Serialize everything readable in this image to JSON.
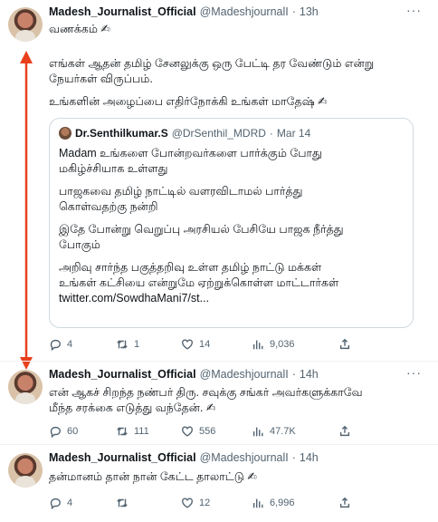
{
  "tweets": [
    {
      "name": "Madesh_Journalist_Official",
      "handle": "@MadeshjournalI",
      "sep": "·",
      "time": "13h",
      "more": "···",
      "lines": [
        "வணக்கம் ✍",
        "எங்கள் ஆதன் தமிழ் சேனலுக்கு ஒரு பேட்டி தர வேண்டும் என்று",
        "நேயர்கள் விருப்பம்.",
        "உங்களின் அழைப்பை எதிர்நோக்கி உங்கள் மாதேஷ் ✍"
      ],
      "quote": {
        "name": "Dr.Senthilkumar.S",
        "handle": "@DrSenthil_MDRD",
        "sep": "·",
        "date": "Mar 14",
        "lines": [
          "Madam உங்களை போன்றவர்களை பார்க்கும் போது",
          "மகிழ்ச்சியாக உள்ளது",
          "பாஜகவை தமிழ் நாட்டில் வளரவிடாமல் பார்த்து",
          "கொள்வதற்கு நன்றி",
          "இதே போன்று வெறுப்பு அரசியல் பேசியே பாஜக நீர்த்து",
          "போகும்",
          "அறிவு சார்ந்த பகுத்தறிவு உள்ள தமிழ் நாட்டு மக்கள்",
          "உங்கள் கட்சியை என்றுமே ஏற்றுக்கொள்ள மாட்டார்கள்",
          "twitter.com/SowdhaMani7/st..."
        ]
      },
      "stats": {
        "replies": "4",
        "retweets": "1",
        "likes": "14",
        "views": "9,036"
      }
    },
    {
      "name": "Madesh_Journalist_Official",
      "handle": "@MadeshjournalI",
      "sep": "·",
      "time": "14h",
      "more": "···",
      "lines": [
        "என் ஆகச் சிறந்த நண்பர் திரு. சவுக்கு சங்கர் அவர்களுக்காவே",
        "மீந்த சரக்கை எடுத்து வந்தேன். ✍"
      ],
      "stats": {
        "replies": "60",
        "retweets": "111",
        "likes": "556",
        "views": "47.7K"
      }
    },
    {
      "name": "Madesh_Journalist_Official",
      "handle": "@MadeshjournalI",
      "sep": "·",
      "time": "14h",
      "more": "",
      "lines": [
        "தன்மானம் தான் நான் கேட்ட தாலாட்டு ✍"
      ],
      "stats": {
        "replies": "4",
        "retweets": "",
        "likes": "12",
        "views": "6,996"
      }
    }
  ],
  "icons": [
    "reply-icon",
    "retweet-icon",
    "like-icon",
    "views-icon",
    "share-icon"
  ],
  "colors": {
    "annotation_arrow": "#e8401c",
    "muted": "#536471",
    "border": "#cfd9de"
  }
}
